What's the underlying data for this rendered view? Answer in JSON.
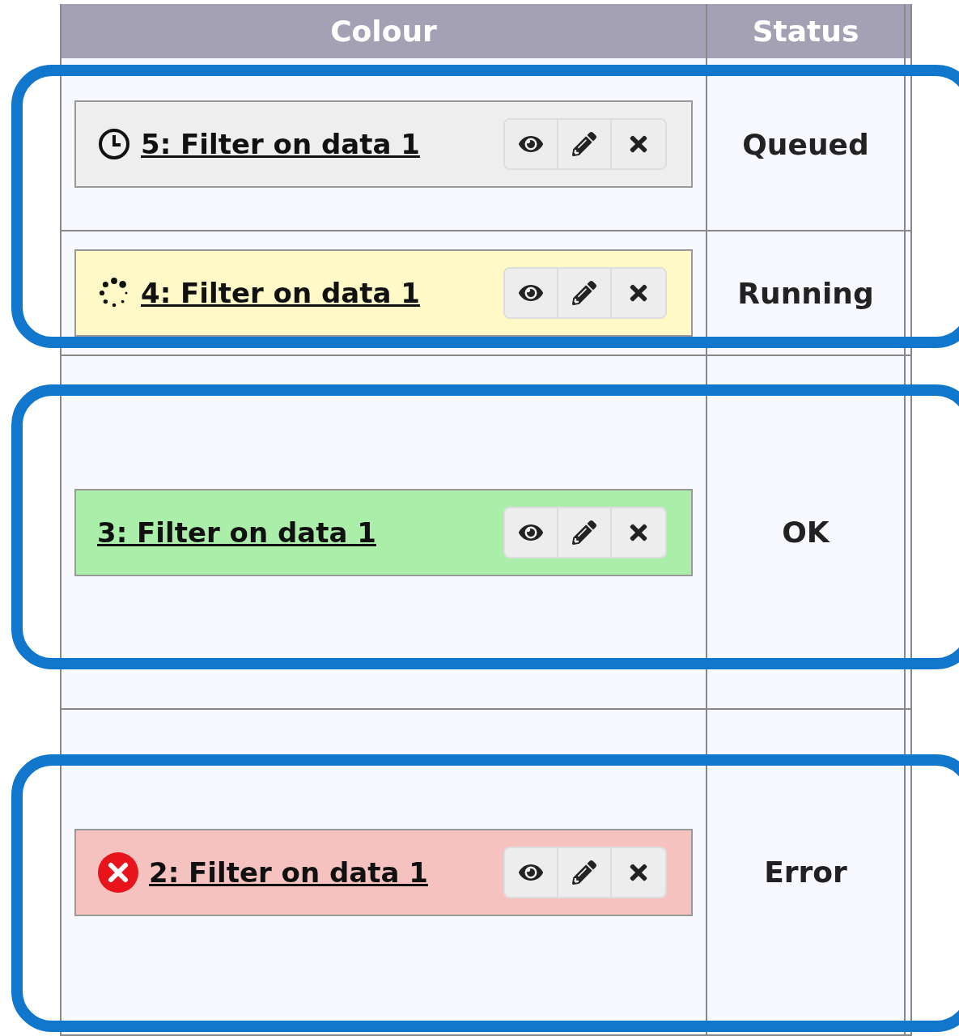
{
  "table": {
    "columns": [
      "Colour",
      "Status"
    ],
    "row_groups": [
      {
        "highlighted": true,
        "rows": [
          {
            "job": {
              "label": "5: Filter on data 1",
              "kind": "queued"
            },
            "status": "Queued"
          },
          {
            "job": {
              "label": "4: Filter on data 1",
              "kind": "running"
            },
            "status": "Running"
          }
        ]
      },
      {
        "highlighted": true,
        "rows": [
          {
            "job": {
              "label": "3: Filter on data 1",
              "kind": "ok"
            },
            "status": "OK"
          }
        ]
      },
      {
        "highlighted": true,
        "rows": [
          {
            "job": {
              "label": "2: Filter on data 1",
              "kind": "error"
            },
            "status": "Error"
          }
        ]
      }
    ]
  }
}
